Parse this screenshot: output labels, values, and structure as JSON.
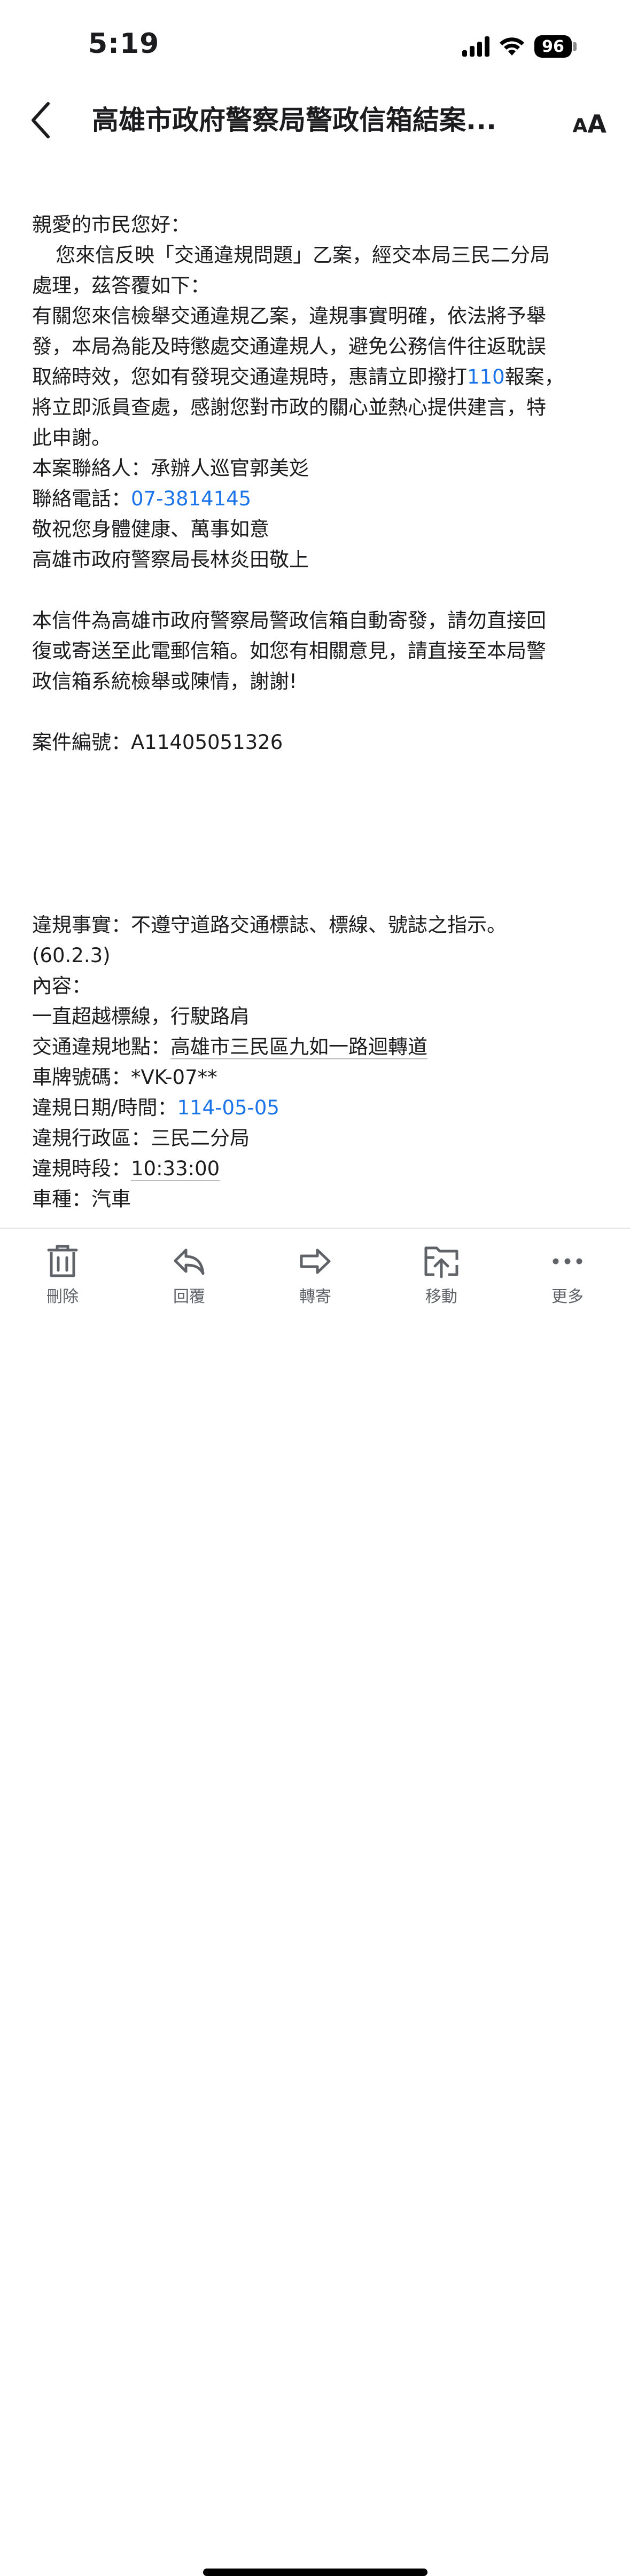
{
  "status_bar": {
    "time": "5:19",
    "battery": "96"
  },
  "nav": {
    "title": "高雄市政府警察局警政信箱結案..."
  },
  "body": {
    "lines": [
      {
        "type": "text",
        "text": "親愛的市民您好："
      },
      {
        "type": "text",
        "text": "您來信反映「交通違規問題」乙案，經交本局三民二分局",
        "indent": true
      },
      {
        "type": "text",
        "text": "處理，茲答覆如下："
      },
      {
        "type": "text",
        "text": "有關您來信檢舉交通違規乙案，違規事實明確，依法將予舉"
      },
      {
        "type": "text",
        "text": "發，本局為能及時懲處交通違規人，避免公務信件往返耽誤"
      },
      {
        "type": "link_mid",
        "before": "取締時效，您如有發現交通違規時，惠請立即撥打",
        "link": "110",
        "after": "報案，"
      },
      {
        "type": "text",
        "text": "將立即派員查處，感謝您對市政的關心並熱心提供建言，特"
      },
      {
        "type": "text",
        "text": "此申謝。"
      },
      {
        "type": "text",
        "text": "本案聯絡人：承辦人巡官郭美彣"
      },
      {
        "type": "label_link",
        "label": "聯絡電話：",
        "value": "07-3814145"
      },
      {
        "type": "text",
        "text": "敬祝您身體健康、萬事如意"
      },
      {
        "type": "text",
        "text": "高雄市政府警察局長林炎田敬上"
      },
      {
        "type": "blank"
      },
      {
        "type": "text",
        "text": "本信件為高雄市政府警察局警政信箱自動寄發，請勿直接回"
      },
      {
        "type": "text",
        "text": "復或寄送至此電郵信箱。如您有相關意見，請直接至本局警"
      },
      {
        "type": "text",
        "text": "政信箱系統檢舉或陳情，謝謝!"
      },
      {
        "type": "blank"
      },
      {
        "type": "text",
        "text": "案件編號：A11405051326"
      },
      {
        "type": "blank"
      },
      {
        "type": "blank"
      },
      {
        "type": "blank"
      },
      {
        "type": "blank"
      },
      {
        "type": "blank"
      },
      {
        "type": "text",
        "text": "違規事實：不遵守道路交通標誌、標線、號誌之指示。"
      },
      {
        "type": "text",
        "text": "(60.2.3)"
      },
      {
        "type": "text",
        "text": "內容："
      },
      {
        "type": "text",
        "text": "一直超越標線，行駛路肩"
      },
      {
        "type": "label_underline",
        "label": "交通違規地點：",
        "value": "高雄市三民區九如一路迴轉道"
      },
      {
        "type": "text",
        "text": "車牌號碼：*VK-07**"
      },
      {
        "type": "label_link",
        "label": "違規日期/時間：",
        "value": "114-05-05"
      },
      {
        "type": "text",
        "text": "違規行政區：三民二分局"
      },
      {
        "type": "label_underline",
        "label": "違規時段：",
        "value": "10:33:00"
      },
      {
        "type": "text",
        "text": "車種：汽車"
      }
    ]
  },
  "toolbar": {
    "items": [
      {
        "name": "delete",
        "label": "刪除",
        "icon": "trash-icon"
      },
      {
        "name": "reply",
        "label": "回覆",
        "icon": "reply-icon"
      },
      {
        "name": "forward",
        "label": "轉寄",
        "icon": "forward-icon"
      },
      {
        "name": "move",
        "label": "移動",
        "icon": "move-icon"
      },
      {
        "name": "more",
        "label": "更多",
        "icon": "more-icon"
      }
    ]
  },
  "colors": {
    "link": "#1a73e8",
    "toolbar_icon": "#5f6368",
    "text": "#1c1c1e"
  }
}
